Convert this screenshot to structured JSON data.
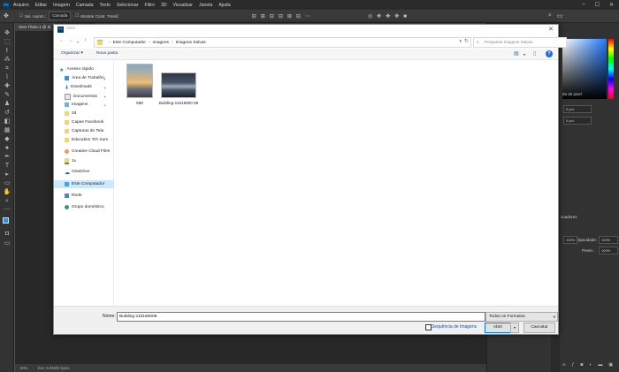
{
  "photoshop": {
    "logo": "Ps",
    "menu": [
      "Arquivo",
      "Editar",
      "Imagem",
      "Camada",
      "Texto",
      "Selecionar",
      "Filtro",
      "3D",
      "Visualizar",
      "Janela",
      "Ajuda"
    ],
    "options": {
      "sel_label": "Sel. Autom.:",
      "sel_value": "Camada",
      "transform_label": "Mostrar Contr. Transf."
    },
    "doc_tab": "Sem Título-1 @ 5(",
    "status": {
      "zoom": "50%",
      "doc": "Doc: 5,93M/0 bytes"
    },
    "panels": {
      "pixel_label": "da de pixel",
      "field_a": "0 pol.",
      "field_b": "0 pol.",
      "layers_title": "ocadores",
      "opacity_label": "Opacidade:",
      "opacity_value": "100%",
      "fill_label": "Preen.:",
      "fill_value": "100%",
      "top_value": "100%"
    }
  },
  "dialog": {
    "title": "Abrir",
    "address": {
      "crumbs": [
        "Este Computador",
        "Imagens",
        "Imagens Salvas"
      ]
    },
    "search_placeholder": "Pesquisar Imagens Salvas",
    "toolbar": {
      "organize": "Organizar ▾",
      "new_folder": "Nova pasta"
    },
    "nav": {
      "quick_access": "Acesso rápido",
      "desktop": "Área de Trabalho",
      "downloads": "Downloads",
      "documents": "Documentos",
      "images": "Imagens",
      "f2d": "2d",
      "capas": "Capas Facebook",
      "capturas": "Capturas de Tela",
      "education": "Education Tch Sum",
      "creative": "Creative Cloud Files",
      "f1x": "1x",
      "onedrive": "OneDrive",
      "computer": "Este Computador",
      "network": "Rede",
      "homegroup": "Grupo doméstico"
    },
    "files": [
      {
        "name": "589"
      },
      {
        "name": "Building-11016000 08"
      }
    ],
    "footer": {
      "name_label": "Nome:",
      "name_value": "Building-110160008",
      "format": "Todos os Formatos",
      "sequence_label": "Sequência de Imagens",
      "open": "Abrir",
      "cancel": "Cancelar"
    }
  },
  "colors": {
    "ps_bg": "#535353",
    "dialog_bg": "#f0f0f0",
    "accent": "#0078d7",
    "selection": "#cce8ff"
  }
}
